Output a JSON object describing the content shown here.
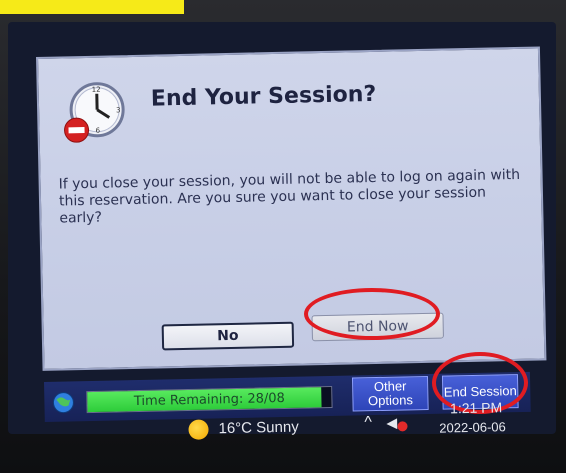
{
  "dialog": {
    "title": "End Your Session?",
    "message": "If you close your session, you will not be able to log on again with this reservation. Are you sure you want to close your session early?",
    "no_label": "No",
    "end_now_label": "End Now"
  },
  "taskbar": {
    "time_remaining_label": "Time Remaining: 28/08",
    "time_remaining_fraction": 0.96,
    "other_options_label": "Other Options",
    "end_session_label": "End Session"
  },
  "system_tray": {
    "weather": "16°C  Sunny",
    "time": "1:21 PM",
    "date": "2022-06-06"
  },
  "icons": [
    "clock-icon",
    "no-entry-icon",
    "globe-icon",
    "sun-icon",
    "chevron-up-icon",
    "speaker-muted-icon"
  ],
  "colors": {
    "annotation": "#e01c22",
    "highlight": "#f6ea18",
    "time_bar": "#2dcc3a",
    "taskbar_button": "#2e45b8"
  }
}
